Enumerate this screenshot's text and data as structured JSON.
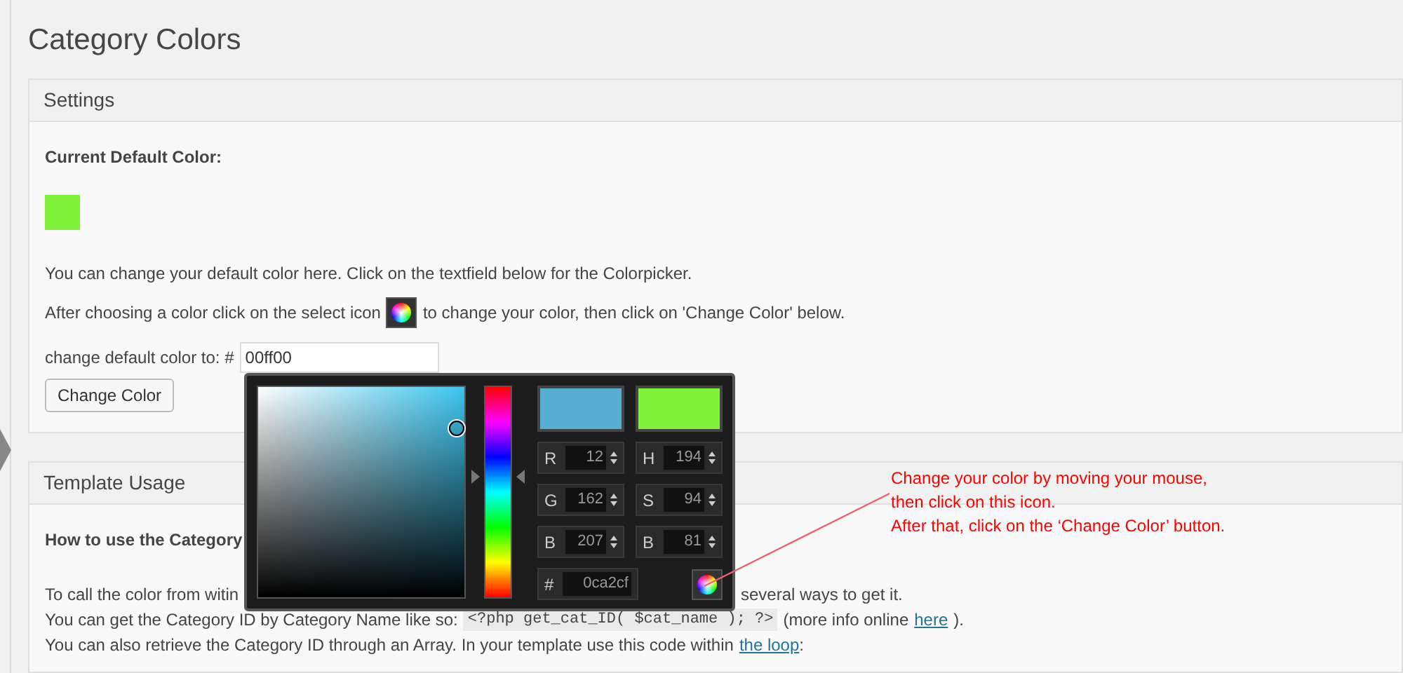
{
  "page": {
    "title": "Category Colors"
  },
  "settings": {
    "title": "Settings",
    "current_label": "Current Default Color:",
    "line_1": "You can change your default color here. Click on the textfield below for the Colorpicker.",
    "line_2_before": "After choosing a color click on the select icon",
    "line_2_after": "to change your color, then click on 'Change Color' below.",
    "field_label": "change default color to: #",
    "field_value": "00ff00",
    "button": "Change Color"
  },
  "colorpicker": {
    "hue_slider": {
      "level": 0.57
    },
    "swatches": [
      {
        "color": "#57aed3"
      },
      {
        "color": "#80f23a"
      }
    ],
    "fields": [
      {
        "label": "R",
        "value": "12"
      },
      {
        "label": "H",
        "value": "194"
      },
      {
        "label": "G",
        "value": "162"
      },
      {
        "label": "S",
        "value": "94"
      },
      {
        "label": "B",
        "value": "207"
      },
      {
        "label": "B",
        "value": "81"
      }
    ],
    "hex_label": "#",
    "hex_value": "0ca2cf"
  },
  "annotation": {
    "lines": [
      "Change your color by moving your mouse,",
      "then click on this icon.",
      "After that, click on the ‘Change Color’ button."
    ]
  },
  "template": {
    "title": "Template Usage",
    "heading": "How to use the Category",
    "line_1_start": "To call the color from witin",
    "line_1_end": "several ways to get it.",
    "line_2": "You can get the Category ID by Category Name like so:",
    "code": "<?php get_cat_ID( $cat_name ); ?>",
    "line_2_after": "(more info online",
    "link_1": "here",
    "line_2_end": ").",
    "line_3": "You can also retrieve the Category ID through an Array. In your template use this code within",
    "link_2": "the loop",
    "line_3_end": ":"
  }
}
